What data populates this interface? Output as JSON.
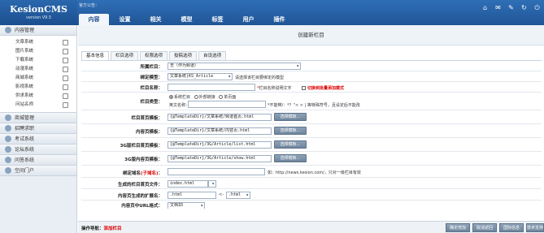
{
  "app": {
    "title": "KesionCMS",
    "version": "version V9.5",
    "announcement": "官方公告："
  },
  "tabs": [
    "内容",
    "设置",
    "相关",
    "模型",
    "标签",
    "用户",
    "插件"
  ],
  "top_icons": [
    "home-icon",
    "mail-icon",
    "tools-icon",
    "refresh-icon",
    "power-icon"
  ],
  "sidebar": {
    "content_section": "内容管理",
    "items": [
      "文章系统",
      "图片系统",
      "下载系统",
      "动漫系统",
      "商城系统",
      "影视系统",
      "供求系统",
      "问站名师"
    ],
    "sections": [
      "商城管理",
      "招聘求职",
      "考试系统",
      "论坛系统",
      "问答系统",
      "空间门户"
    ]
  },
  "main": {
    "title": "创建新栏目",
    "subtabs": [
      "基本信息",
      "栏目选项",
      "权限选项",
      "投稿选项",
      "自设选项"
    ]
  },
  "form": {
    "parent": {
      "label": "所属栏目：",
      "value": "无（作为频道）"
    },
    "model": {
      "label": "绑定模型：",
      "value": "文章系统|KS_Article",
      "note": "请选择该栏目要绑定的模型"
    },
    "name": {
      "label": "栏目名称：",
      "note": "栏目名称说明文字",
      "batch": "切换到批量添加模式"
    },
    "type": {
      "label": "栏目类型：",
      "options": [
        "系统栏目",
        "外部链接",
        "单页面"
      ],
      "en_label": "英文名称：",
      "en_note": "*不能带/：*？\"< > | 等特殊符号，且设定后不能改"
    },
    "tpl_index": {
      "label": "栏目首页模板：",
      "value": "{@TemplateDir}/文章系统/频道首页.html",
      "btn": "选择模板..."
    },
    "tpl_content": {
      "label": "内容页模板：",
      "value": "{@TemplateDir}/文章系统/内容页.html",
      "btn": "选择模板..."
    },
    "tpl_3g_index": {
      "label": "3G版栏目首页模板：",
      "value": "{@TemplateDir}/3G/Article/list.html",
      "btn": "选择模板..."
    },
    "tpl_3g_content": {
      "label": "3G版内容页模板：",
      "value": "{@TemplateDir}/3G/Article/show.html",
      "btn": "选择模板..."
    },
    "domain": {
      "label_a": "绑定域名",
      "label_b": "(子域名)",
      "label_c": "：",
      "note": "如：http://news.kesion.com/，只对一级栏目有效"
    },
    "index_file": {
      "label": "生成的栏目首页文件：",
      "value": "index.html"
    },
    "ext": {
      "label": "内容页生成的扩展名：",
      "value": ".html",
      "value2": ".html"
    },
    "paging": {
      "label": "内容页中URL格式：",
      "value": "文档ID"
    }
  },
  "bottom": {
    "nav_label": "操作导航：",
    "crumb": "添加栏目",
    "buttons": [
      "确定增加",
      "取消返回",
      "国际信息",
      "技术支持"
    ]
  }
}
